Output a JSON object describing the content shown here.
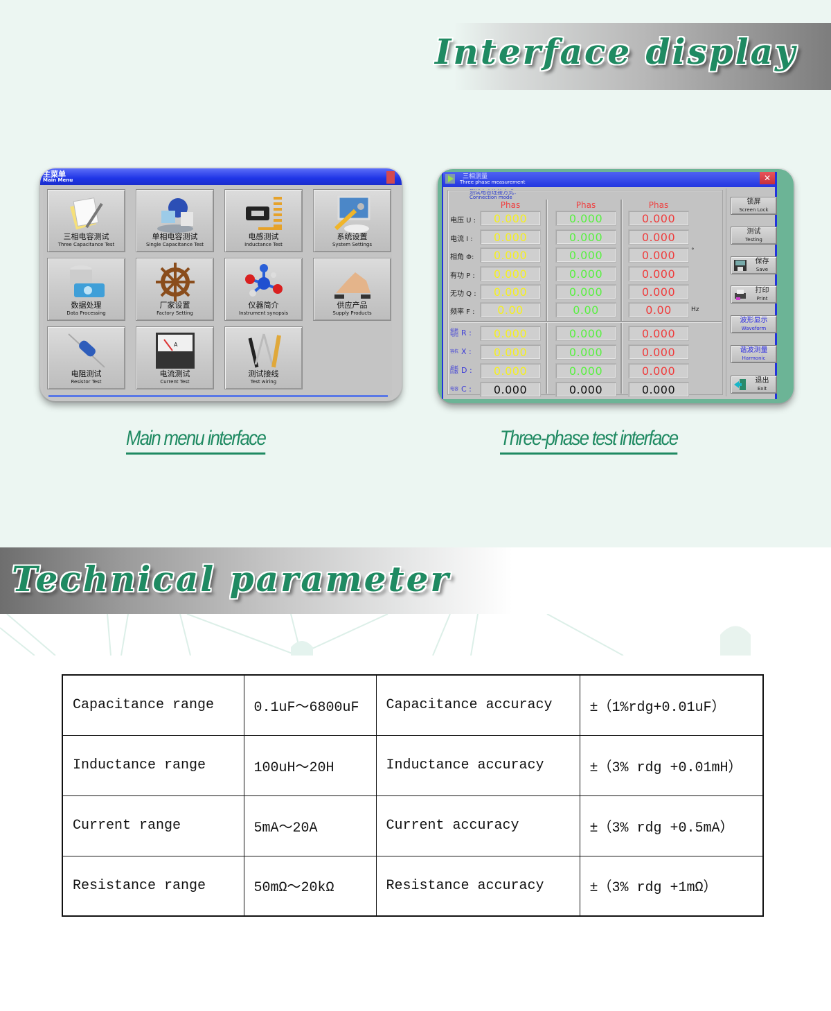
{
  "interface_section": {
    "title": "Interface display",
    "main_menu_caption": "Main menu interface",
    "three_phase_caption": "Three-phase test interface"
  },
  "main_menu_window": {
    "title_cn": "主菜单",
    "title_en": "Main Menu",
    "tiles": [
      {
        "cn": "三相电容测试",
        "en": "Three Capacitance Test",
        "icon": "document-pen-icon"
      },
      {
        "cn": "单相电容测试",
        "en": "Single Capacitance Test",
        "icon": "globe-folder-icon"
      },
      {
        "cn": "电感测试",
        "en": "Inductance Test",
        "icon": "spring-clamp-icon"
      },
      {
        "cn": "系统设置",
        "en": "System Settings",
        "icon": "monitor-keys-icon"
      },
      {
        "cn": "数据处理",
        "en": "Data Processing",
        "icon": "database-disk-icon"
      },
      {
        "cn": "厂家设置",
        "en": "Factory Setting",
        "icon": "ship-wheel-icon"
      },
      {
        "cn": "仪器简介",
        "en": "Instrument synopsis",
        "icon": "molecule-icon"
      },
      {
        "cn": "供应产品",
        "en": "Supply Products",
        "icon": "handshake-icon"
      },
      {
        "cn": "电阻测试",
        "en": "Resistor  Test",
        "icon": "resistor-icon"
      },
      {
        "cn": "电流测试",
        "en": "Current Test",
        "icon": "ammeter-icon"
      },
      {
        "cn": "测试接线",
        "en": "Test wiring",
        "icon": "drafting-tools-icon"
      }
    ]
  },
  "three_phase_window": {
    "title_cn": "三相测量",
    "title_en": "Three phase measurement",
    "close_label": "✕",
    "connection_cn": "测试电容连接方式：",
    "connection_en": "Connection mode",
    "phase_headers": [
      "Phas",
      "Phas",
      "Phas"
    ],
    "rows": [
      {
        "label": "电压 U :",
        "values": [
          "0.000",
          "0.000",
          "0.000"
        ],
        "unit": ""
      },
      {
        "label": "电流  I :",
        "values": [
          "0.000",
          "0.000",
          "0.000"
        ],
        "unit": ""
      },
      {
        "label": "相角 Φ:",
        "values": [
          "0.000",
          "0.000",
          "0.000"
        ],
        "unit": "°"
      },
      {
        "label": "有功 P :",
        "values": [
          "0.000",
          "0.000",
          "0.000"
        ],
        "unit": ""
      },
      {
        "label": "无功 Q :",
        "values": [
          "0.000",
          "0.000",
          "0.000"
        ],
        "unit": ""
      },
      {
        "label": "频率 F :",
        "values": [
          "0.00",
          "0.00",
          "0.00"
        ],
        "unit": "Hz"
      }
    ],
    "rows2": [
      {
        "label_small": "损耗电阻",
        "label": "R :",
        "values": [
          "0.000",
          "0.000",
          "0.000"
        ]
      },
      {
        "label_small": "容抗",
        "label": "X :",
        "values": [
          "0.000",
          "0.000",
          "0.000"
        ]
      },
      {
        "label_small": "损耗因数",
        "label": "D :",
        "values": [
          "0.000",
          "0.000",
          "0.000"
        ]
      },
      {
        "label_small": "电容",
        "label": "C :",
        "values": [
          "0.000",
          "0.000",
          "0.000"
        ]
      }
    ],
    "side_buttons": [
      {
        "cn": "锁屏",
        "en": "Screen Lock"
      },
      {
        "cn": "测试",
        "en": "Testing"
      },
      {
        "cn": "保存",
        "en": "Save"
      },
      {
        "cn": "打印",
        "en": "Print"
      },
      {
        "cn": "波形显示",
        "en": "Waveform"
      },
      {
        "cn": "谐波测量",
        "en": "Harmonic"
      },
      {
        "cn": "退出",
        "en": "Exit"
      }
    ]
  },
  "technical_section": {
    "title": "Technical parameter",
    "table": [
      [
        "Capacitance range",
        "0.1uF～6800uF",
        "Capacitance accuracy",
        "±（1%rdg+0.01uF）"
      ],
      [
        "Inductance range",
        "100uH～20H",
        "Inductance accuracy",
        "±（3% rdg +0.01mH）"
      ],
      [
        "Current range",
        "5mA～20A",
        "Current accuracy",
        "±（3% rdg +0.5mA）"
      ],
      [
        "Resistance range",
        "50mΩ～20kΩ",
        "Resistance accuracy",
        "±（3% rdg +1mΩ）"
      ]
    ]
  },
  "colors": {
    "brand_green": "#1f8a62",
    "phase_a": "#f5f020",
    "phase_b": "#58f040",
    "phase_c": "#ef3b3b",
    "titlebar_blue": "#1f35e6"
  }
}
